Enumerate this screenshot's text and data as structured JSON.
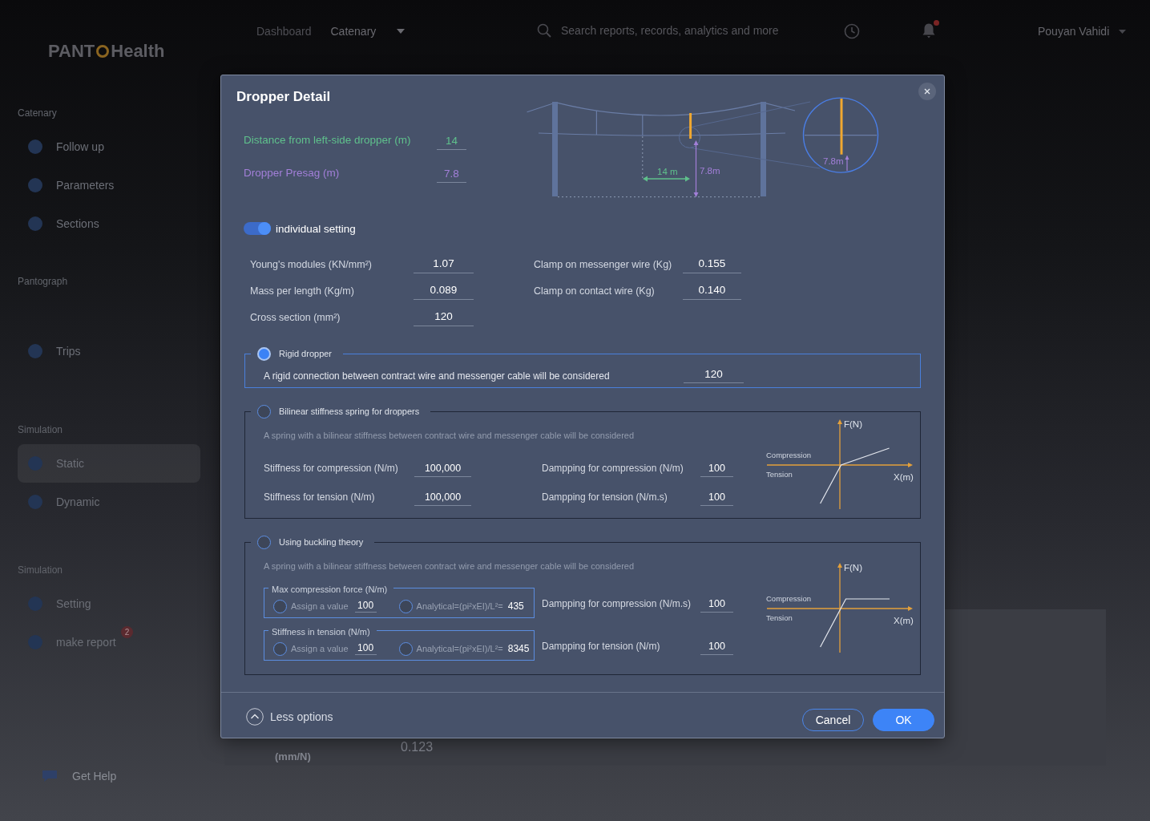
{
  "app": {
    "logo": {
      "start": "PANT",
      "end": "Health"
    },
    "nav": [
      {
        "kind": "link",
        "label": "Dashboard",
        "selected": false
      },
      {
        "kind": "dropdown",
        "label": "Catenary",
        "selected": true
      }
    ],
    "search": {
      "placeholder": "Search reports, records, analytics and more"
    },
    "notifications": {
      "unread": true
    },
    "user": {
      "name": "Pouyan Vahidi"
    }
  },
  "sidebar": {
    "groups": [
      {
        "title": "Catenary",
        "items": [
          {
            "label": "Follow up",
            "selected": false
          },
          {
            "label": "Parameters",
            "selected": false
          },
          {
            "label": "Sections",
            "selected": false
          }
        ]
      },
      {
        "title": "Pantograph",
        "items": [
          {
            "label": "Trips",
            "selected": false
          }
        ]
      },
      {
        "title": "Simulation",
        "items": [
          {
            "label": "Static",
            "selected": true
          },
          {
            "label": "Dynamic",
            "selected": false
          }
        ]
      },
      {
        "title": "Simulation",
        "items": [
          {
            "label": "Setting",
            "selected": false
          },
          {
            "label": "make report",
            "selected": false,
            "badge": "2"
          }
        ]
      }
    ],
    "help": {
      "label": "Get Help"
    }
  },
  "background_card": {
    "column_1": "(mm/N)",
    "column_2": "0.123"
  },
  "dialog": {
    "title": "Dropper Detail",
    "position_fields": [
      {
        "kind": "distance",
        "label": "Distance from left-side dropper (m)",
        "value": "14",
        "color": "#5fc08c"
      },
      {
        "kind": "presag",
        "label": "Dropper Presag (m)",
        "value": "7.8",
        "color": "#a27fd8"
      }
    ],
    "diagram": {
      "distance_label": "14 m",
      "presag_label": "7.8m",
      "magnified_label": "7.8m"
    },
    "individual_setting": {
      "label": "individual setting",
      "on": true
    },
    "properties": {
      "left": [
        {
          "label": "Young's modules (KN/mm²)",
          "value": "1.07"
        },
        {
          "label": "Mass per length (Kg/m)",
          "value": "0.089"
        },
        {
          "label": "Cross section (mm²)",
          "value": "120"
        }
      ],
      "right": [
        {
          "label": "Clamp on messenger wire (Kg)",
          "value": "0.155"
        },
        {
          "label": "Clamp on contact wire (Kg)",
          "value": "0.140"
        }
      ]
    },
    "dropper_models": [
      {
        "kind": "rigid",
        "title": "Rigid dropper",
        "selected": true,
        "description": "A rigid connection between contract wire and messenger cable will be considered",
        "value": "120"
      },
      {
        "kind": "bilinear",
        "title": "Bilinear stiffness spring for droppers",
        "selected": false,
        "description": "A spring with a bilinear stiffness between contract wire and messenger cable will be considered",
        "left_fields": [
          {
            "label": "Stiffness for compression (N/m)",
            "value": "100,000"
          },
          {
            "label": "Stiffness for tension (N/m)",
            "value": "100,000"
          }
        ],
        "right_fields": [
          {
            "label": "Dampping for compression (N/m)",
            "value": "100"
          },
          {
            "label": "Dampping for tension (N/m.s)",
            "value": "100"
          }
        ],
        "graph": {
          "y_axis": "F(N)",
          "x_axis": "X(m)",
          "upper_label": "Compression",
          "lower_label": "Tension"
        }
      },
      {
        "kind": "buckling",
        "title": "Using buckling theory",
        "selected": false,
        "description": "A spring with a bilinear stiffness between contract wire and messenger cable will be considered",
        "option_groups": [
          {
            "title": "Max compression force (N/m)",
            "options": [
              {
                "kind": "assign",
                "label": "Assign a value",
                "value": "100",
                "selected": false
              },
              {
                "kind": "analytical",
                "label": "Analytical=(pi²xEI)/L²=",
                "value": "435",
                "selected": false
              }
            ]
          },
          {
            "title": "Stiffness in tension (N/m)",
            "options": [
              {
                "kind": "assign",
                "label": "Assign a value",
                "value": "100",
                "selected": false
              },
              {
                "kind": "analytical",
                "label": "Analytical=(pi²xEI)/L²=",
                "value": "8345",
                "selected": false
              }
            ]
          }
        ],
        "right_fields": [
          {
            "label": "Dampping for compression (N/m.s)",
            "value": "100"
          },
          {
            "label": "Dampping for tension (N/m)",
            "value": "100"
          }
        ],
        "graph": {
          "y_axis": "F(N)",
          "x_axis": "X(m)",
          "upper_label": "Compression",
          "lower_label": "Tension"
        }
      }
    ],
    "less_options": {
      "label": "Less options",
      "expanded": true
    },
    "buttons": [
      {
        "kind": "secondary",
        "label": "Cancel"
      },
      {
        "kind": "primary",
        "label": "OK"
      }
    ]
  }
}
